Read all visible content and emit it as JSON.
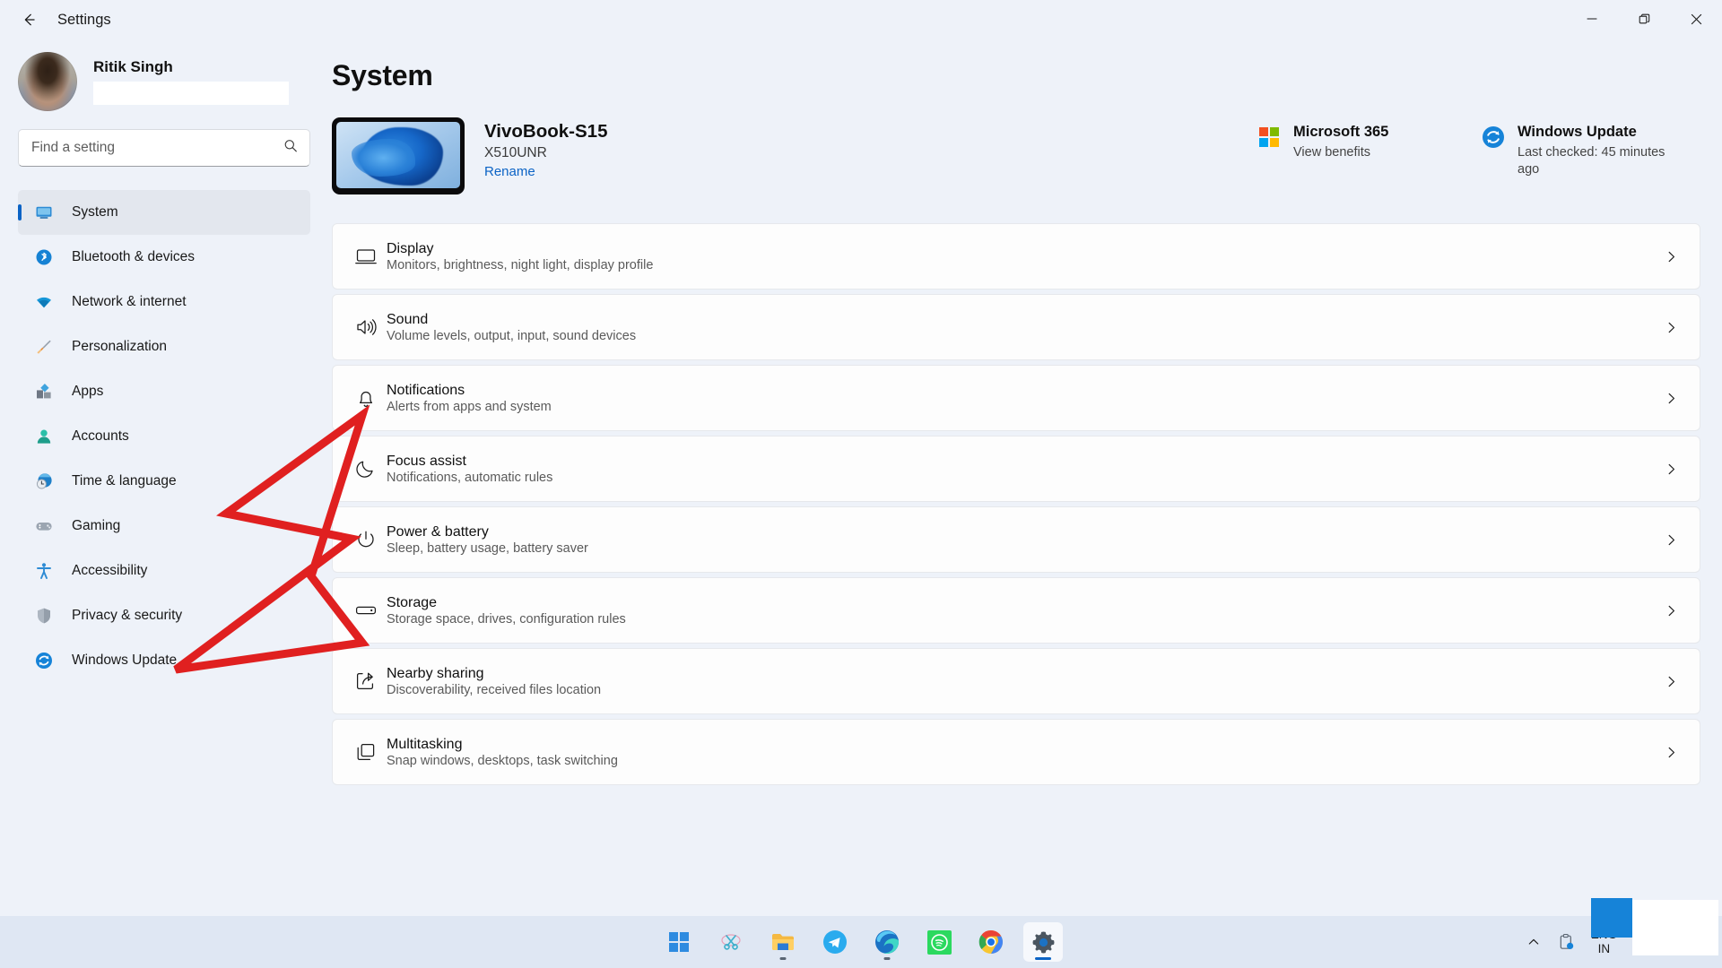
{
  "window": {
    "title": "Settings",
    "back_icon": "back-arrow-icon",
    "minimize_icon": "minimize-icon",
    "maximize_icon": "maximize-icon",
    "close_icon": "close-icon"
  },
  "account": {
    "name": "Ritik Singh",
    "email_redacted": ""
  },
  "search": {
    "placeholder": "Find a setting",
    "value": "",
    "icon": "search-icon"
  },
  "sidebar": {
    "items": [
      {
        "label": "System",
        "icon": "monitor-icon",
        "active": true
      },
      {
        "label": "Bluetooth & devices",
        "icon": "bluetooth-icon",
        "active": false
      },
      {
        "label": "Network & internet",
        "icon": "wifi-icon",
        "active": false
      },
      {
        "label": "Personalization",
        "icon": "paintbrush-icon",
        "active": false
      },
      {
        "label": "Apps",
        "icon": "apps-grid-icon",
        "active": false
      },
      {
        "label": "Accounts",
        "icon": "person-icon",
        "active": false
      },
      {
        "label": "Time & language",
        "icon": "clock-globe-icon",
        "active": false
      },
      {
        "label": "Gaming",
        "icon": "gamepad-icon",
        "active": false
      },
      {
        "label": "Accessibility",
        "icon": "accessibility-icon",
        "active": false
      },
      {
        "label": "Privacy & security",
        "icon": "shield-icon",
        "active": false
      },
      {
        "label": "Windows Update",
        "icon": "update-refresh-icon",
        "active": false
      }
    ]
  },
  "main": {
    "title": "System",
    "device": {
      "name": "VivoBook-S15",
      "model": "X510UNR",
      "rename_label": "Rename",
      "thumbnail": "windows-bloom-wallpaper"
    },
    "promos": [
      {
        "title": "Microsoft 365",
        "subtitle": "View benefits",
        "icon": "microsoft-logo-icon"
      },
      {
        "title": "Windows Update",
        "subtitle": "Last checked: 45 minutes ago",
        "icon": "update-refresh-icon"
      }
    ],
    "settings": [
      {
        "title": "Display",
        "subtitle": "Monitors, brightness, night light, display profile",
        "icon": "display-icon"
      },
      {
        "title": "Sound",
        "subtitle": "Volume levels, output, input, sound devices",
        "icon": "speaker-icon"
      },
      {
        "title": "Notifications",
        "subtitle": "Alerts from apps and system",
        "icon": "bell-icon"
      },
      {
        "title": "Focus assist",
        "subtitle": "Notifications, automatic rules",
        "icon": "moon-icon"
      },
      {
        "title": "Power & battery",
        "subtitle": "Sleep, battery usage, battery saver",
        "icon": "power-icon"
      },
      {
        "title": "Storage",
        "subtitle": "Storage space, drives, configuration rules",
        "icon": "drive-icon"
      },
      {
        "title": "Nearby sharing",
        "subtitle": "Discoverability, received files location",
        "icon": "share-icon"
      },
      {
        "title": "Multitasking",
        "subtitle": "Snap windows, desktops, task switching",
        "icon": "multitask-icon"
      }
    ],
    "row_chevron": "chevron-right-icon"
  },
  "annotation": {
    "type": "arrow",
    "color": "#E02020",
    "points_to": "Windows Update"
  },
  "taskbar": {
    "items": [
      {
        "name": "start-button",
        "icon": "windows-logo-icon",
        "active": false,
        "running": false
      },
      {
        "name": "snipping-tool",
        "icon": "scissors-icon",
        "active": false,
        "running": false
      },
      {
        "name": "file-explorer",
        "icon": "folder-icon",
        "active": false,
        "running": true
      },
      {
        "name": "telegram",
        "icon": "telegram-icon",
        "active": false,
        "running": false
      },
      {
        "name": "microsoft-edge",
        "icon": "edge-icon",
        "active": false,
        "running": true
      },
      {
        "name": "spotify",
        "icon": "spotify-icon",
        "active": false,
        "running": false
      },
      {
        "name": "google-chrome",
        "icon": "chrome-icon",
        "active": false,
        "running": false
      },
      {
        "name": "settings",
        "icon": "gear-icon",
        "active": true,
        "running": true
      }
    ],
    "tray": {
      "overflow_icon": "chevron-up-icon",
      "clipboard_icon": "clipboard-icon",
      "language_primary": "ENG",
      "language_secondary": "IN",
      "wifi_icon": "wifi-icon",
      "volume_icon": "volume-icon",
      "battery_icon": "battery-icon"
    }
  },
  "colors": {
    "accent": "#0b63c5",
    "page_bg": "#eef2f9",
    "card_bg": "#fdfdfd",
    "taskbar_bg": "#dfe7f3",
    "annotation_red": "#E02020"
  }
}
